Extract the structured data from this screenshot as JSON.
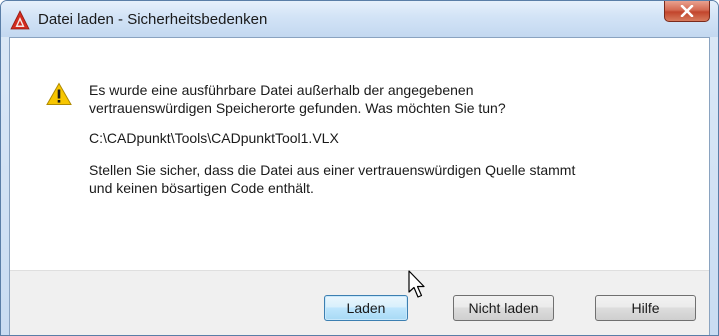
{
  "dialog": {
    "title": "Datei laden - Sicherheitsbedenken",
    "app_icon": "autocad-logo-icon",
    "close_icon": "close-icon",
    "warning_icon": "warning-icon",
    "message": "Es wurde eine ausführbare Datei außerhalb der angegebenen\nvertrauenswürdigen Speicherorte gefunden. Was möchten Sie tun?",
    "file_path": "C:\\CADpunkt\\Tools\\CADpunktTool1.VLX",
    "advice": "Stellen Sie sicher, dass die Datei aus einer vertrauenswürdigen Quelle stammt\nund keinen bösartigen Code enthält."
  },
  "buttons": {
    "load_label": "Laden",
    "dont_load_label": "Nicht laden",
    "help_label": "Hilfe"
  },
  "colors": {
    "title_gradient_top": "#e6f0fb",
    "close_button_red": "#c2452c",
    "primary_button_border": "#3c7fb1",
    "warning_yellow": "#f7c600"
  }
}
